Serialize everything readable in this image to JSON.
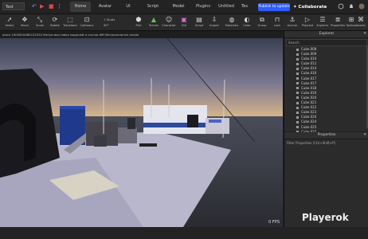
{
  "topbar": {
    "project": "Test",
    "menu_tabs": [
      "Home",
      "Avatar",
      "UI",
      "Script",
      "Model",
      "Plugins",
      "Untitled",
      "Tes"
    ],
    "publish_label": "Publish to update",
    "collaborate_label": "Collaborate"
  },
  "toolbar": {
    "tools": [
      "Select",
      "Move",
      "Scale",
      "Rotate",
      "Transform",
      "Collisions",
      "Part",
      "Terrain",
      "Character",
      "GUI",
      "Script",
      "Import",
      "Materials",
      "Color",
      "Group",
      "Lock",
      "Anchor",
      "Playtest",
      "Explorer",
      "Properties",
      "Toolbox",
      "Assets"
    ],
    "stud1": "1 Studs",
    "stud2": "90°"
  },
  "doc_tab": "place 1905816485152254 Метро выставка моделей и состав ИМ Метрополитен studio",
  "viewport": {
    "fps": "0 FPS",
    "sky_top": "#3a3f52",
    "sky_horizon": "#d9b68a",
    "ground": "#34353c"
  },
  "explorer": {
    "title": "Explorer",
    "search_placeholder": "Search",
    "items": [
      "Cube.008",
      "Cube.009",
      "Cube.010",
      "Cube.011",
      "Cube.014",
      "Cube.016",
      "Cube.017",
      "Cube.017",
      "Cube.018",
      "Cube.019",
      "Cube.020",
      "Cube.021",
      "Cube.022",
      "Cube.023",
      "Cube.024",
      "Cube.024",
      "Cube.025",
      "Cube.025"
    ]
  },
  "properties": {
    "title": "Properties",
    "filter_placeholder": "Filter Properties (Ctrl+Shift+P)"
  },
  "watermark": "Playerok"
}
